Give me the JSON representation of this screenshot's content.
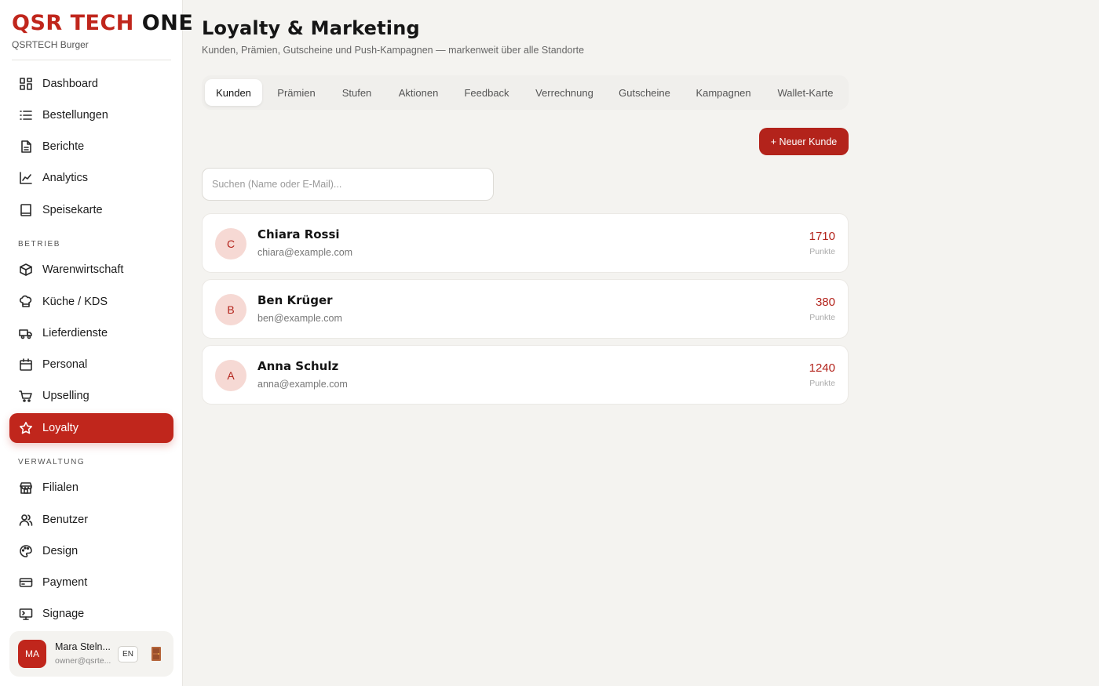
{
  "brand": {
    "logo_part1": "QSR",
    "logo_part2": "TECH",
    "logo_part3": "ONE",
    "subtitle": "QSRTECH Burger"
  },
  "nav": {
    "main": [
      {
        "label": "Dashboard",
        "icon": "grid-icon"
      },
      {
        "label": "Bestellungen",
        "icon": "list-icon"
      },
      {
        "label": "Berichte",
        "icon": "document-icon"
      },
      {
        "label": "Analytics",
        "icon": "chart-line-icon"
      },
      {
        "label": "Speisekarte",
        "icon": "book-icon"
      }
    ],
    "section_betrieb": "BETRIEB",
    "betrieb": [
      {
        "label": "Warenwirtschaft",
        "icon": "box-icon"
      },
      {
        "label": "Küche / KDS",
        "icon": "chef-hat-icon"
      },
      {
        "label": "Lieferdienste",
        "icon": "truck-icon"
      },
      {
        "label": "Personal",
        "icon": "calendar-icon"
      },
      {
        "label": "Upselling",
        "icon": "cart-icon"
      },
      {
        "label": "Loyalty",
        "icon": "star-icon",
        "active": true
      }
    ],
    "section_verwaltung": "VERWALTUNG",
    "verwaltung": [
      {
        "label": "Filialen",
        "icon": "store-icon"
      },
      {
        "label": "Benutzer",
        "icon": "users-icon"
      },
      {
        "label": "Design",
        "icon": "palette-icon"
      },
      {
        "label": "Payment",
        "icon": "credit-card-icon"
      },
      {
        "label": "Signage",
        "icon": "monitor-icon"
      }
    ]
  },
  "user": {
    "initials": "MA",
    "name": "Mara Steln...",
    "email": "owner@qsrte...",
    "language": "EN"
  },
  "page": {
    "title": "Loyalty & Marketing",
    "subtitle": "Kunden, Prämien, Gutscheine und Push-Kampagnen — markenweit über alle Standorte"
  },
  "tabs": [
    "Kunden",
    "Prämien",
    "Stufen",
    "Aktionen",
    "Feedback",
    "Verrechnung",
    "Gutscheine",
    "Kampagnen",
    "Wallet-Karte"
  ],
  "active_tab": "Kunden",
  "new_button": "+ Neuer Kunde",
  "search": {
    "placeholder": "Suchen (Name oder E-Mail)..."
  },
  "points_label": "Punkte",
  "customers": [
    {
      "initial": "C",
      "name": "Chiara Rossi",
      "email": "chiara@example.com",
      "points": "1710"
    },
    {
      "initial": "B",
      "name": "Ben Krüger",
      "email": "ben@example.com",
      "points": "380"
    },
    {
      "initial": "A",
      "name": "Anna Schulz",
      "email": "anna@example.com",
      "points": "1240"
    }
  ],
  "colors": {
    "accent": "#c0261c",
    "accent_dark": "#b3231b",
    "background": "#f4f3f0",
    "avatar_bg": "#f6d9d4"
  }
}
